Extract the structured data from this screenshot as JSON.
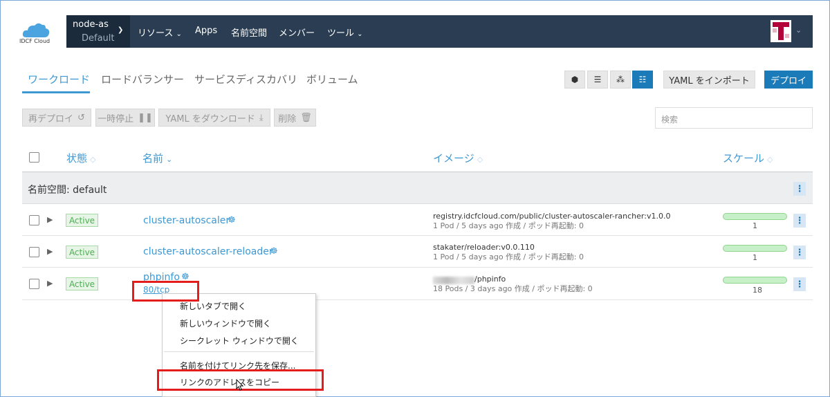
{
  "logo": {
    "text": "IDCF Cloud"
  },
  "topnav": {
    "cluster_name": "node-as",
    "cluster_project": "Default",
    "items": [
      "リソース",
      "Apps",
      "名前空間",
      "メンバー",
      "ツール"
    ]
  },
  "tabs": [
    "ワークロード",
    "ロードバランサー",
    "サービスディスカバリ",
    "ボリューム"
  ],
  "toolbar": {
    "import_label": "YAML をインポート",
    "deploy_label": "デプロイ"
  },
  "bulk_actions": {
    "redeploy": "再デプロイ",
    "pause": "一時停止",
    "download_yaml": "YAML をダウンロード",
    "delete": "削除"
  },
  "search": {
    "placeholder": "検索"
  },
  "table": {
    "headers": {
      "state": "状態",
      "name": "名前",
      "image": "イメージ",
      "scale": "スケール"
    },
    "namespace_label": "名前空間: default",
    "rows": [
      {
        "state": "Active",
        "name": "cluster-autoscaler",
        "image": "registry.idcfcloud.com/public/cluster-autoscaler-rancher:v1.0.0",
        "detail": "1 Pod / 5 days ago 作成 / ポッド再起動: 0",
        "scale": "1"
      },
      {
        "state": "Active",
        "name": "cluster-autoscaler-reloader",
        "image": "stakater/reloader:v0.0.110",
        "detail": "1 Pod / 5 days ago 作成 / ポッド再起動: 0",
        "scale": "1"
      },
      {
        "state": "Active",
        "name": "phpinfo",
        "port": "80/tcp",
        "image": "/phpinfo",
        "detail": "18 Pods / 3 days ago 作成 / ポッド再起動: 0",
        "scale": "18"
      }
    ]
  },
  "context_menu": {
    "items": [
      "新しいタブで開く",
      "新しいウィンドウで開く",
      "シークレット ウィンドウで開く",
      "名前を付けてリンク先を保存...",
      "リンクのアドレスをコピー"
    ]
  },
  "colors": {
    "accent": "#3d98d3",
    "primary_button": "#1b7bb8",
    "nav_bg": "#2a3d52",
    "highlight": "#e51c1c"
  }
}
